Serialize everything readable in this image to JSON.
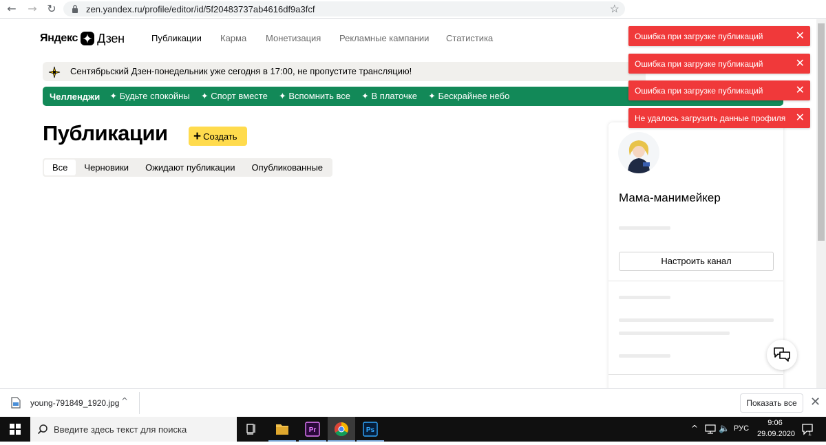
{
  "browser": {
    "url": "zen.yandex.ru/profile/editor/id/5f20483737ab4616df9a3fcf"
  },
  "header": {
    "logo_yandex": "Яндекс",
    "logo_dzen": "Дзен",
    "nav": [
      {
        "label": "Публикации",
        "active": true
      },
      {
        "label": "Карма",
        "active": false
      },
      {
        "label": "Монетизация",
        "active": false
      },
      {
        "label": "Рекламные кампании",
        "active": false
      },
      {
        "label": "Статистика",
        "active": false
      }
    ]
  },
  "promo": {
    "text": "Сентябрьский Дзен-понедельник уже сегодня в 17:00, не пропустите трансляцию!"
  },
  "challenges": {
    "title": "Челленджи",
    "items": [
      "✦ Будьте спокойны",
      "✦ Спорт вместе",
      "✦ Вспомнить все",
      "✦ В платочке",
      "✦ Бескрайнее небо"
    ]
  },
  "main": {
    "title": "Публикации",
    "create_label": "Создать",
    "tabs": [
      {
        "label": "Все",
        "active": true
      },
      {
        "label": "Черновики",
        "active": false
      },
      {
        "label": "Ожидают публикации",
        "active": false
      },
      {
        "label": "Опубликованные",
        "active": false
      }
    ]
  },
  "profile": {
    "name": "Мама-манимейкер",
    "setup_label": "Настроить канал"
  },
  "toasts": [
    {
      "text": "Ошибка при загрузке публикаций"
    },
    {
      "text": "Ошибка при загрузке публикаций"
    },
    {
      "text": "Ошибка при загрузке публикаций"
    },
    {
      "text": "Не удалось загрузить данные профиля"
    }
  ],
  "downloads": {
    "filename": "young-791849_1920.jpg",
    "show_all": "Показать все"
  },
  "taskbar": {
    "search_placeholder": "Введите здесь текст для поиска",
    "lang": "РУС",
    "time": "9:06",
    "date": "29.09.2020",
    "notifications": "1"
  },
  "colors": {
    "toast_bg": "#f0393a",
    "challenge_bg": "#128958",
    "create_btn": "#ffdb4d"
  }
}
